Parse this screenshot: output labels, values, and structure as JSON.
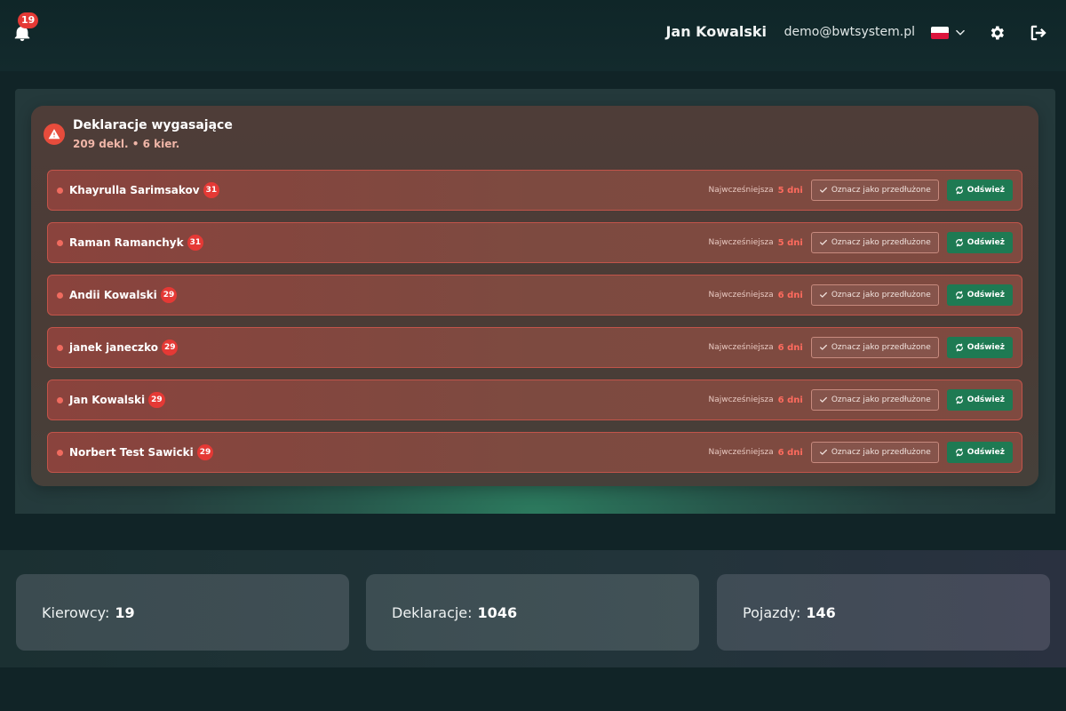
{
  "header": {
    "notifications_count": "19",
    "user_name": "Jan Kowalski",
    "user_email": "demo@bwtsystem.pl",
    "language_flag": "pl-flag-icon"
  },
  "alert": {
    "title": "Deklaracje wygasające",
    "subtitle": "209 dekl. • 6 kier.",
    "earliest_label": "Najwcześniejsza",
    "mark_button_label": "Oznacz jako przedłużone",
    "refresh_button_label": "Odśwież",
    "rows": [
      {
        "name": "Khayrulla Sarimsakov",
        "count": "31",
        "earliest": "5 dni"
      },
      {
        "name": "Raman Ramanchyk",
        "count": "31",
        "earliest": "5 dni"
      },
      {
        "name": "Andii Kowalski",
        "count": "29",
        "earliest": "6 dni"
      },
      {
        "name": "janek janeczko",
        "count": "29",
        "earliest": "6 dni"
      },
      {
        "name": "Jan Kowalski",
        "count": "29",
        "earliest": "6 dni"
      },
      {
        "name": "Norbert Test Sawicki",
        "count": "29",
        "earliest": "6 dni"
      }
    ]
  },
  "stats": {
    "drivers_label": "Kierowcy:",
    "drivers_value": "19",
    "declarations_label": "Deklaracje:",
    "declarations_value": "1046",
    "vehicles_label": "Pojazdy:",
    "vehicles_value": "146"
  },
  "colors": {
    "danger": "#e53935",
    "success": "#1e7a53",
    "accent_text": "#ff6b5e"
  }
}
